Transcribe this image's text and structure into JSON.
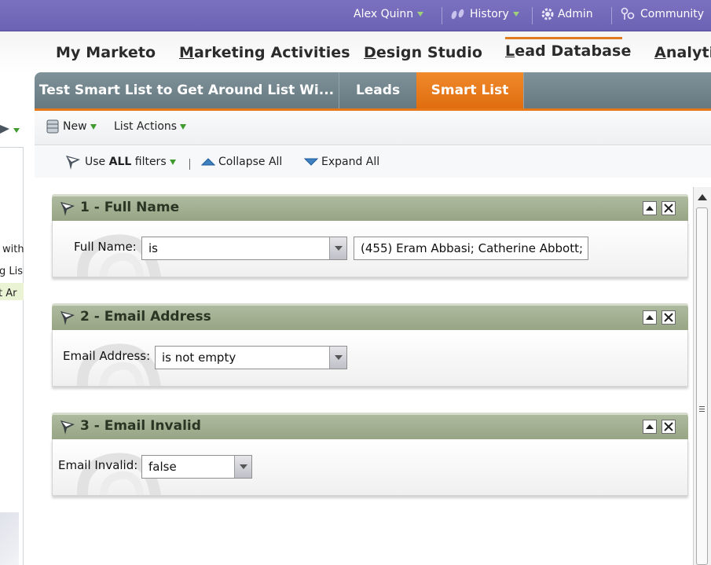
{
  "topbar": {
    "user": "Alex Quinn",
    "history": "History",
    "admin": "Admin",
    "community": "Community"
  },
  "nav": {
    "tabs": [
      {
        "label": "My Marketo"
      },
      {
        "label_underlined": "M",
        "label_rest": "arketing Activities"
      },
      {
        "label_underlined": "D",
        "label_rest": "esign Studio"
      },
      {
        "label_underlined": "L",
        "label_rest": "ead Database"
      },
      {
        "label_underlined": "A",
        "label_rest": "nalytic"
      }
    ],
    "active": "Lead Database"
  },
  "sidebar": {
    "fragments": [
      "with",
      "g Lis",
      "t Ar"
    ]
  },
  "subtabs": {
    "items": [
      {
        "label": "Test Smart List to Get Around List Wi..."
      },
      {
        "label": "Leads"
      },
      {
        "label": "Smart List"
      }
    ],
    "active": "Smart List"
  },
  "toolbar": {
    "new_label": "New",
    "list_actions_label": "List Actions"
  },
  "filterbar": {
    "use_prefix": "Use ",
    "use_all": "ALL",
    "use_suffix": " filters",
    "collapse_all": "Collapse All",
    "expand_all": "Expand All"
  },
  "filters": [
    {
      "title": "1 - Full Name",
      "field_label": "Full Name:",
      "operator": "is",
      "value": "(455) Eram Abbasi; Catherine Abbott;"
    },
    {
      "title": "2 - Email Address",
      "field_label": "Email Address:",
      "operator": "is not empty"
    },
    {
      "title": "3 - Email Invalid",
      "field_label": "Email Invalid:",
      "operator": "false"
    }
  ],
  "colors": {
    "topbar": "#6b62b3",
    "accent_orange": "#e6781a",
    "subtab_gray": "#6f8189",
    "card_header": "#a3b092",
    "dropdown_green": "#3f9b2e"
  },
  "icons": {
    "history": "footprints-icon",
    "admin": "gear-icon",
    "community": "people-icon",
    "new": "database-icon",
    "filter": "funnel-icon",
    "collapse": "triangle-up-icon",
    "expand": "triangle-down-icon",
    "card_collapse": "collapse-card-icon",
    "card_close": "close-icon"
  }
}
